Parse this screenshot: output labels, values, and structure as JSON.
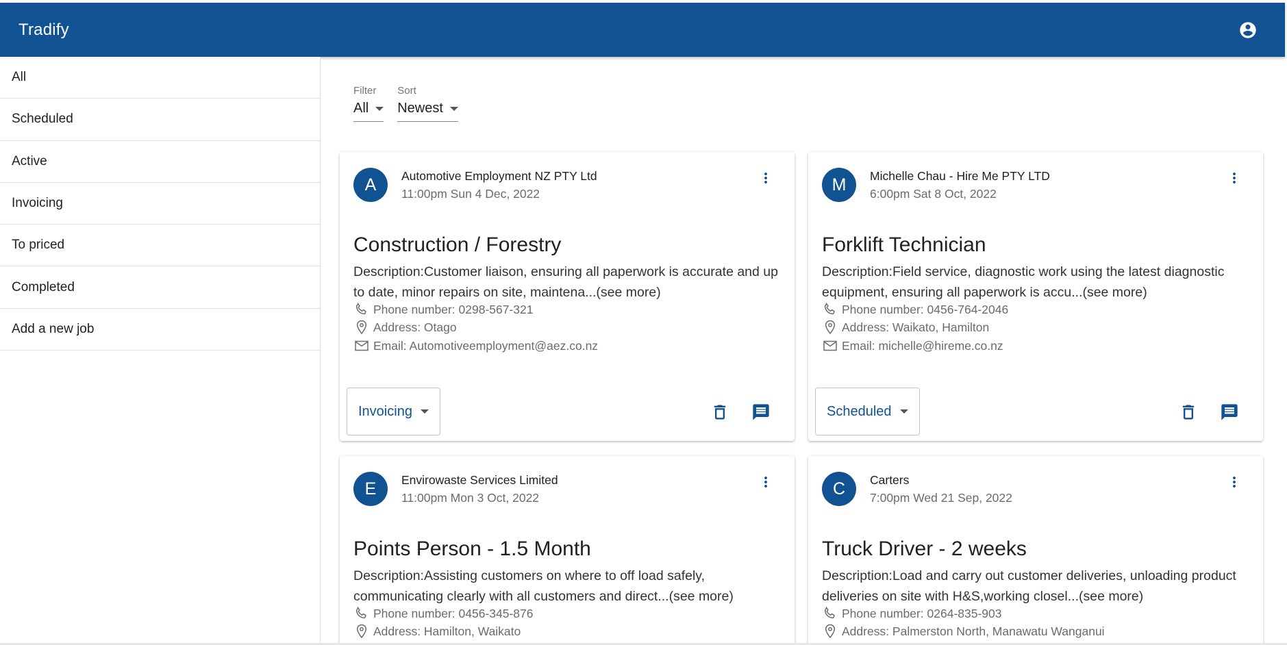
{
  "app": {
    "title": "Tradify",
    "account_icon": "account-circle-icon"
  },
  "theme": {
    "primary": "#115293"
  },
  "sidebar": {
    "items": [
      {
        "label": "All"
      },
      {
        "label": "Scheduled"
      },
      {
        "label": "Active"
      },
      {
        "label": "Invoicing"
      },
      {
        "label": "To priced"
      },
      {
        "label": "Completed"
      },
      {
        "label": "Add a new job"
      }
    ]
  },
  "filters": {
    "filter": {
      "label": "Filter",
      "value": "All"
    },
    "sort": {
      "label": "Sort",
      "value": "Newest"
    }
  },
  "jobs": [
    {
      "avatar": "A",
      "company": "Automotive Employment NZ PTY Ltd",
      "date": "11:00pm Sun 4 Dec, 2022",
      "title": "Construction / Forestry",
      "description": "Description:Customer liaison, ensuring all paperwork is accurate and up to date, minor repairs on site, maintena...(see more)",
      "phone": "Phone number: 0298-567-321",
      "address": "Address: Otago",
      "email": "Email: Automotiveemployment@aez.co.nz",
      "status": "Invoicing"
    },
    {
      "avatar": "M",
      "company": "Michelle Chau - Hire Me PTY LTD",
      "date": "6:00pm Sat 8 Oct, 2022",
      "title": "Forklift Technician",
      "description": "Description:Field service, diagnostic work using the latest diagnostic equipment, ensuring all paperwork is accu...(see more)",
      "phone": "Phone number: 0456-764-2046",
      "address": "Address: Waikato, Hamilton",
      "email": "Email: michelle@hireme.co.nz",
      "status": "Scheduled"
    },
    {
      "avatar": "E",
      "company": "Envirowaste Services Limited",
      "date": "11:00pm Mon 3 Oct, 2022",
      "title": "Points Person - 1.5 Month",
      "description": "Description:Assisting customers on where to off load safely, communicating clearly with all customers and direct...(see more)",
      "phone": "Phone number: 0456-345-876",
      "address": "Address: Hamilton, Waikato",
      "email": "",
      "status": ""
    },
    {
      "avatar": "C",
      "company": "Carters",
      "date": "7:00pm Wed 21 Sep, 2022",
      "title": "Truck Driver - 2 weeks",
      "description": "Description:Load and carry out customer deliveries, unloading product deliveries on site with H&S,working closel...(see more)",
      "phone": "Phone number: 0264-835-903",
      "address": "Address: Palmerston North, Manawatu Wanganui",
      "email": "",
      "status": ""
    }
  ]
}
